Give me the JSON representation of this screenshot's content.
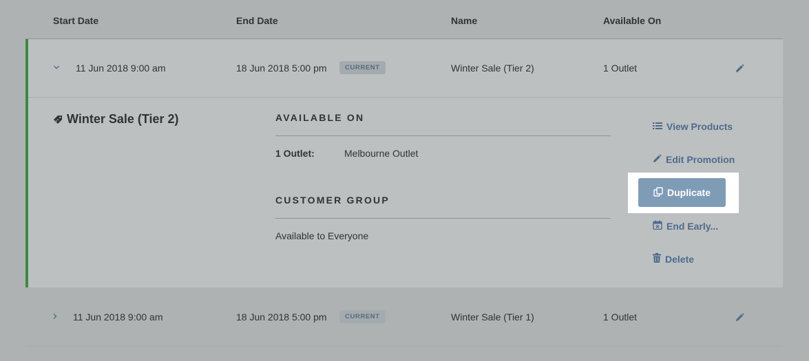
{
  "table": {
    "headers": {
      "start": "Start Date",
      "end": "End Date",
      "name": "Name",
      "available": "Available On"
    },
    "rows": [
      {
        "start": "11 Jun 2018 9:00 am",
        "end": "18 Jun 2018 5:00 pm",
        "badge": "CURRENT",
        "name": "Winter Sale (Tier 2)",
        "available": "1 Outlet",
        "expanded": true,
        "chevron": "chevron-down-icon"
      },
      {
        "start": "11 Jun 2018 9:00 am",
        "end": "18 Jun 2018 5:00 pm",
        "badge": "CURRENT",
        "name": "Winter Sale (Tier 1)",
        "available": "1 Outlet",
        "expanded": false,
        "chevron": "chevron-right-icon"
      }
    ]
  },
  "detail": {
    "title": "Winter Sale (Tier 2)",
    "available_heading": "AVAILABLE ON",
    "outlet_label": "1 Outlet:",
    "outlet_value": "Melbourne Outlet",
    "customer_heading": "CUSTOMER GROUP",
    "customer_value": "Available to Everyone"
  },
  "actions": {
    "view_products": "View Products",
    "edit_promotion": "Edit Promotion",
    "duplicate": "Duplicate",
    "end_early": "End Early...",
    "delete": "Delete"
  },
  "colors": {
    "accent_green": "#3b8a3f",
    "link_blue": "#4c6b8b",
    "button_blue": "#7f9cb7"
  }
}
